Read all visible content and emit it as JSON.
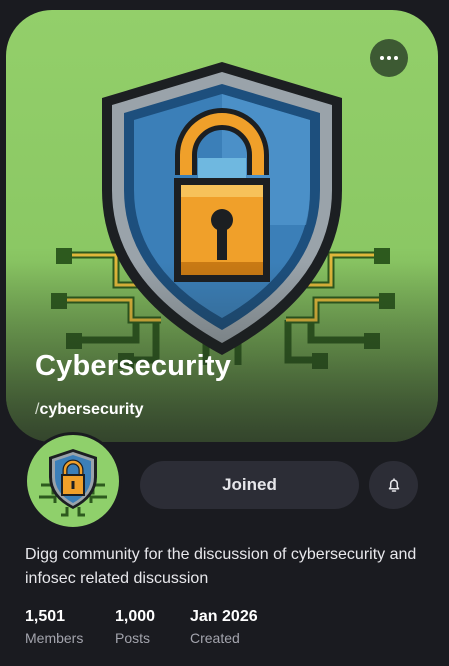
{
  "community": {
    "name": "Cybersecurity",
    "slug_prefix": "/",
    "slug": "cybersecurity",
    "description": "Digg community for the discussion of cybersecurity and infosec related discussion"
  },
  "actions": {
    "more_icon": "more-horizontal-icon",
    "joined_label": "Joined",
    "bell_icon": "bell-icon"
  },
  "stats": [
    {
      "value": "1,501",
      "label": "Members"
    },
    {
      "value": "1,000",
      "label": "Posts"
    },
    {
      "value": "Jan 2026",
      "label": "Created"
    }
  ],
  "colors": {
    "background": "#1a1b20",
    "banner_green": "#8bc864",
    "button_bg": "#2c2d36",
    "shield_blue": "#3b7fb8",
    "lock_orange": "#f0a02a"
  }
}
